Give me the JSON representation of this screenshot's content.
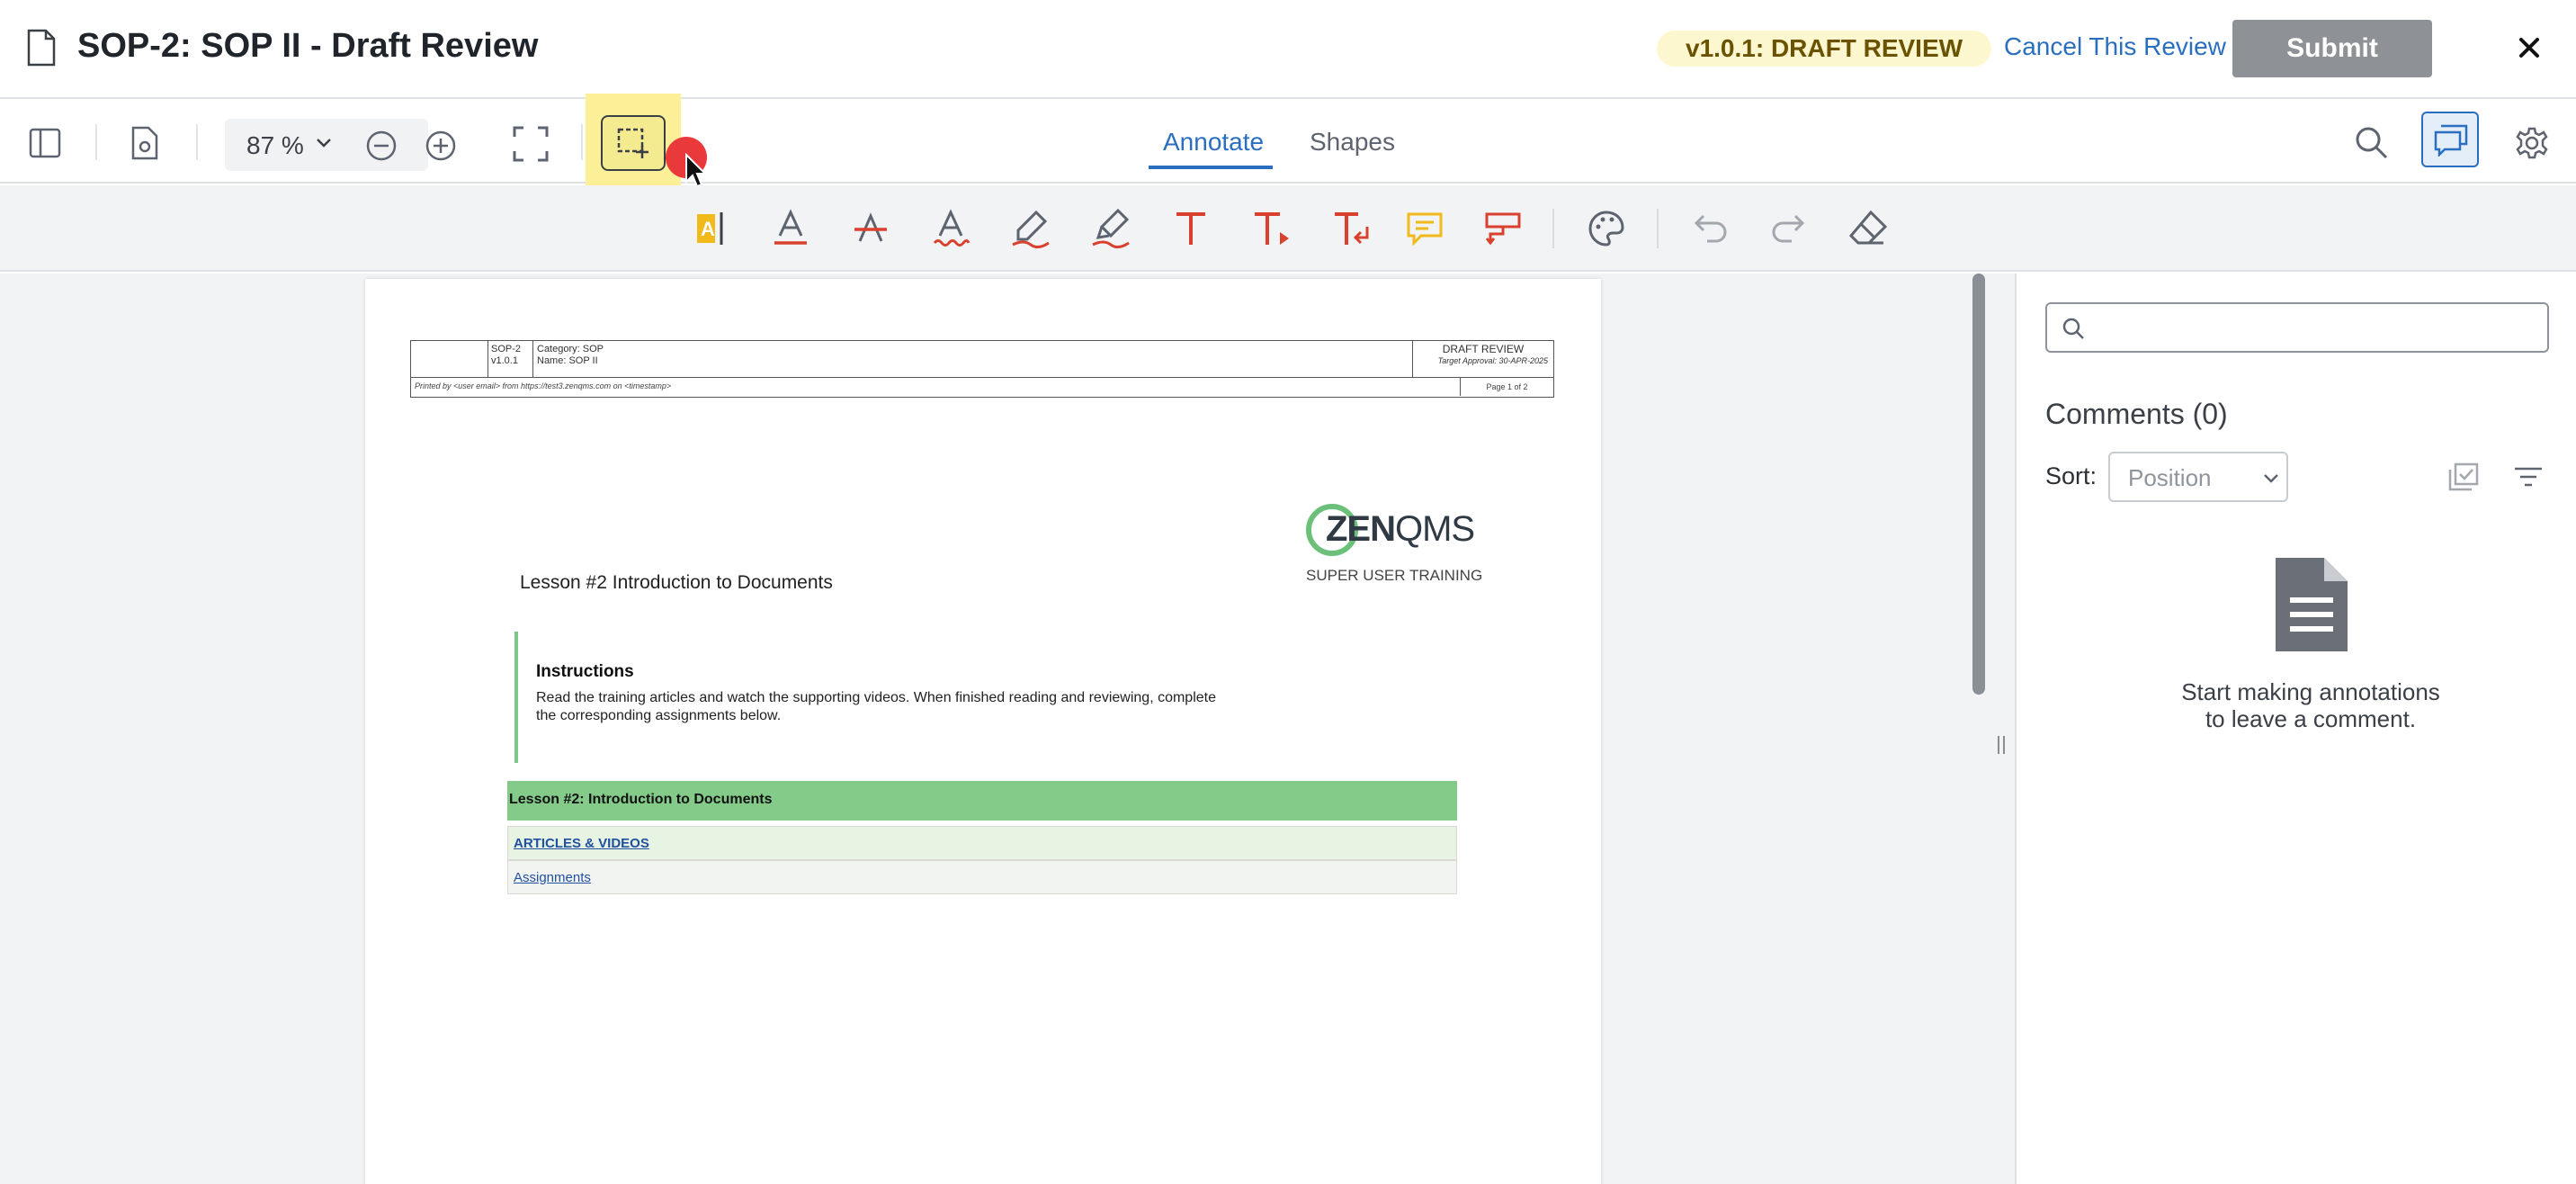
{
  "header": {
    "title": "SOP-2: SOP II - Draft Review",
    "version_badge": "v1.0.1: DRAFT REVIEW",
    "cancel_label": "Cancel This Review",
    "submit_label": "Submit"
  },
  "toolbar": {
    "zoom_value": "87 %",
    "tabs": [
      "Annotate",
      "Shapes"
    ],
    "active_tab": "Annotate"
  },
  "annotation_tools": [
    "text-highlight-icon",
    "text-underline-icon",
    "text-strikeout-icon",
    "text-squiggly-icon",
    "freehand-icon",
    "freehand-highlight-icon",
    "free-text-icon",
    "callout-icon",
    "text-replace-icon",
    "sticky-note-icon",
    "redact-icon",
    "color-palette-icon",
    "undo-icon",
    "redo-icon",
    "eraser-icon"
  ],
  "document": {
    "header_table": {
      "doc_id": "SOP-2",
      "doc_version": "v1.0.1",
      "category": "Category: SOP",
      "name": "Name: SOP II",
      "status": "DRAFT REVIEW",
      "target_approval": "Target Approval: 30-APR-2025",
      "printed_by": "Printed by <user email> from https://test3.zenqms.com on <timestamp>",
      "page_info": "Page 1 of 2"
    },
    "logo_prefix": "ZEN",
    "logo_suffix": "QMS",
    "logo_subtitle": "SUPER USER TRAINING",
    "lesson_heading": "Lesson #2 Introduction to Documents",
    "instructions_title": "Instructions",
    "instructions_text": "Read the training articles and watch the supporting videos. When finished reading and reviewing, complete the corresponding assignments below.",
    "table_header": "Lesson #2: Introduction to Documents",
    "table_rows": [
      "ARTICLES & VIDEOS",
      "Assignments"
    ]
  },
  "comments_panel": {
    "title": "Comments (0)",
    "sort_label": "Sort:",
    "sort_value": "Position",
    "empty_line1": "Start making annotations",
    "empty_line2": "to leave a comment."
  },
  "colors": {
    "accent": "#2a6ec0",
    "badge_bg": "#fdf7cf",
    "submit_bg": "#8e9196",
    "annotation_red": "#d9412e",
    "note_yellow": "#f2b91a",
    "doc_green": "#84cb8a"
  }
}
